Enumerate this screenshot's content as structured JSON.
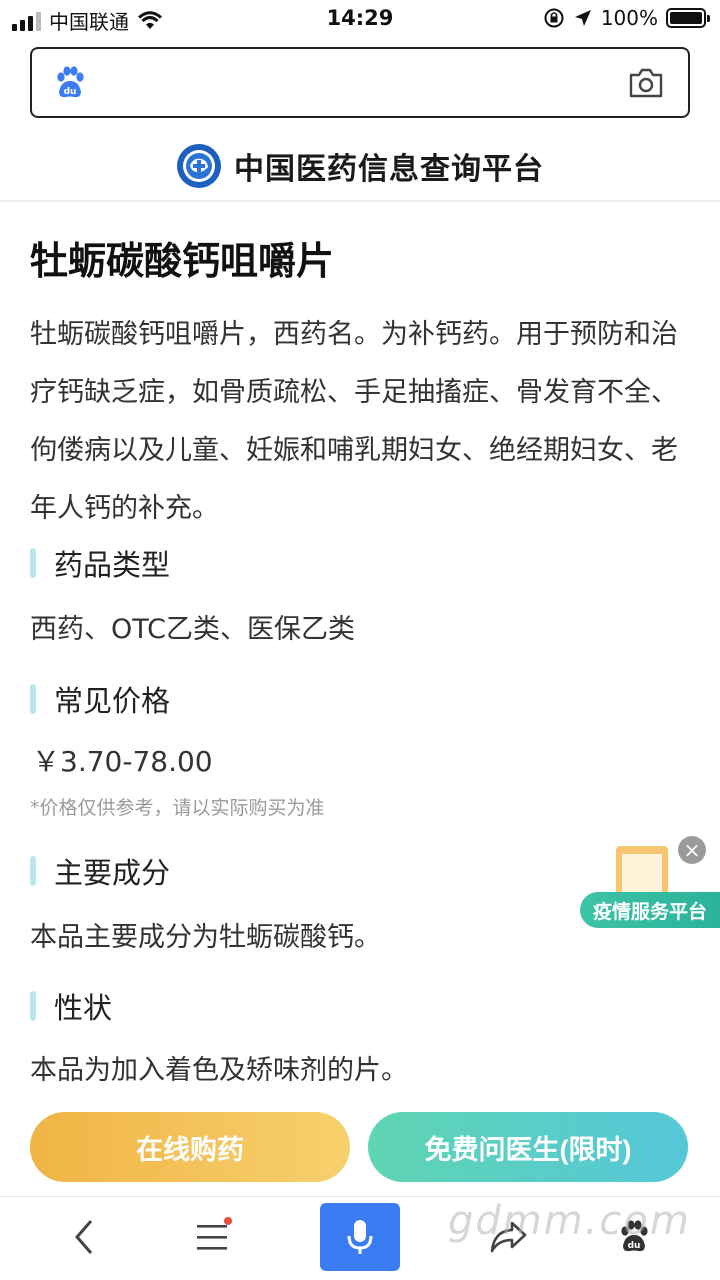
{
  "status_bar": {
    "carrier": "中国联通",
    "time": "14:29",
    "battery": "100%",
    "battery_level": 1.0
  },
  "search": {
    "placeholder": ""
  },
  "platform": {
    "title": "中国医药信息查询平台"
  },
  "drug": {
    "title": "牡蛎碳酸钙咀嚼片",
    "intro": "牡蛎碳酸钙咀嚼片，西药名。为补钙药。用于预防和治疗钙缺乏症，如骨质疏松、手足抽搐症、骨发育不全、佝偻病以及儿童、妊娠和哺乳期妇女、绝经期妇女、老年人钙的补充。"
  },
  "sections": {
    "type_label": "药品类型",
    "type_value": "西药、OTC乙类、医保乙类",
    "price_label": "常见价格",
    "price_value": "￥3.70-78.00",
    "price_note": "*价格仅供参考，请以实际购买为准",
    "ingredient_label": "主要成分",
    "ingredient_value": "本品主要成分为牡蛎碳酸钙。",
    "character_label": "性状",
    "character_value": "本品为加入着色及矫味剂的片。"
  },
  "float_badge": {
    "label": "疫情服务平台"
  },
  "actions": {
    "buy_label": "在线购药",
    "doctor_label": "免费问医生(限时)"
  },
  "watermark": "gdmm.com",
  "colors": {
    "accent_blue": "#3b7cf2",
    "section_bar": "#b9e7ee",
    "buy_gradient_start": "#f0b445",
    "doctor_gradient_start": "#5fd5b2"
  }
}
